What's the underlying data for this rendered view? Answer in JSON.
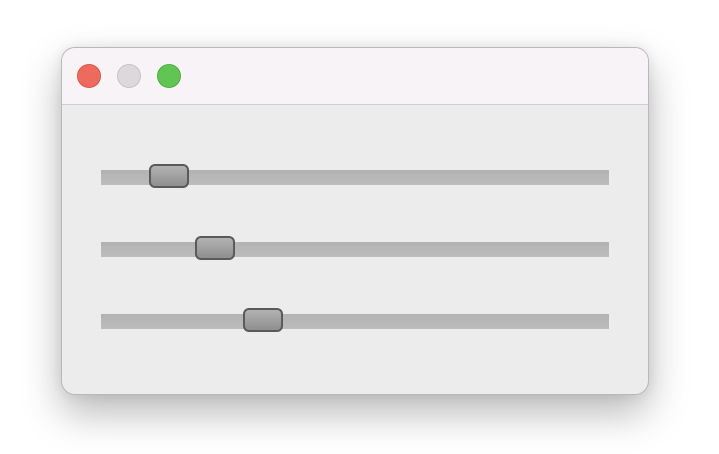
{
  "window": {
    "controls": {
      "close": {
        "icon": "close-circle-icon",
        "color": "#ee6a5f"
      },
      "minimize": {
        "icon": "minimize-circle-icon",
        "color": "#dcd8dc"
      },
      "zoom": {
        "icon": "zoom-circle-icon",
        "color": "#61c554"
      }
    }
  },
  "sliders": [
    {
      "value": 0.133
    },
    {
      "value": 0.224
    },
    {
      "value": 0.319
    }
  ]
}
